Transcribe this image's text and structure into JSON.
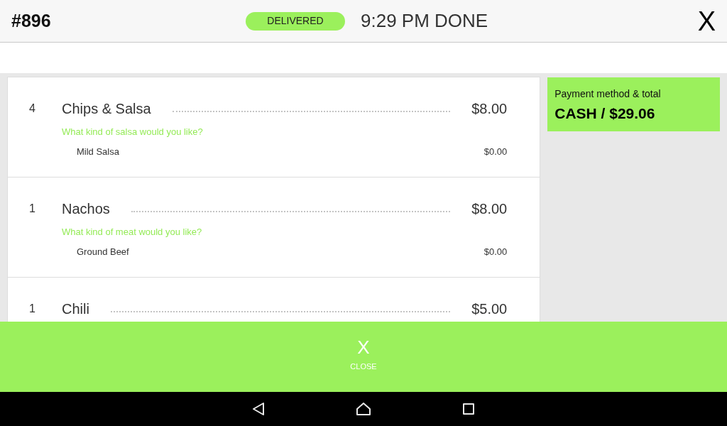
{
  "header": {
    "order_number": "#896",
    "status_badge": "DELIVERED",
    "time_status": "9:29 PM DONE",
    "close_label": "X"
  },
  "items": [
    {
      "quantity": "4",
      "name": "Chips & Salsa",
      "price": "$8.00",
      "modifiers": [
        {
          "question": "What kind of salsa would you like?",
          "options": [
            {
              "name": "Mild Salsa",
              "price": "$0.00"
            }
          ]
        }
      ]
    },
    {
      "quantity": "1",
      "name": "Nachos",
      "price": "$8.00",
      "modifiers": [
        {
          "question": "What kind of meat would you like?",
          "options": [
            {
              "name": "Ground Beef",
              "price": "$0.00"
            }
          ]
        }
      ]
    },
    {
      "quantity": "1",
      "name": "Chili",
      "price": "$5.00"
    }
  ],
  "payment": {
    "label": "Payment method & total",
    "value": "CASH / $29.06"
  },
  "close_bar": {
    "icon_label": "X",
    "label": "CLOSE"
  }
}
